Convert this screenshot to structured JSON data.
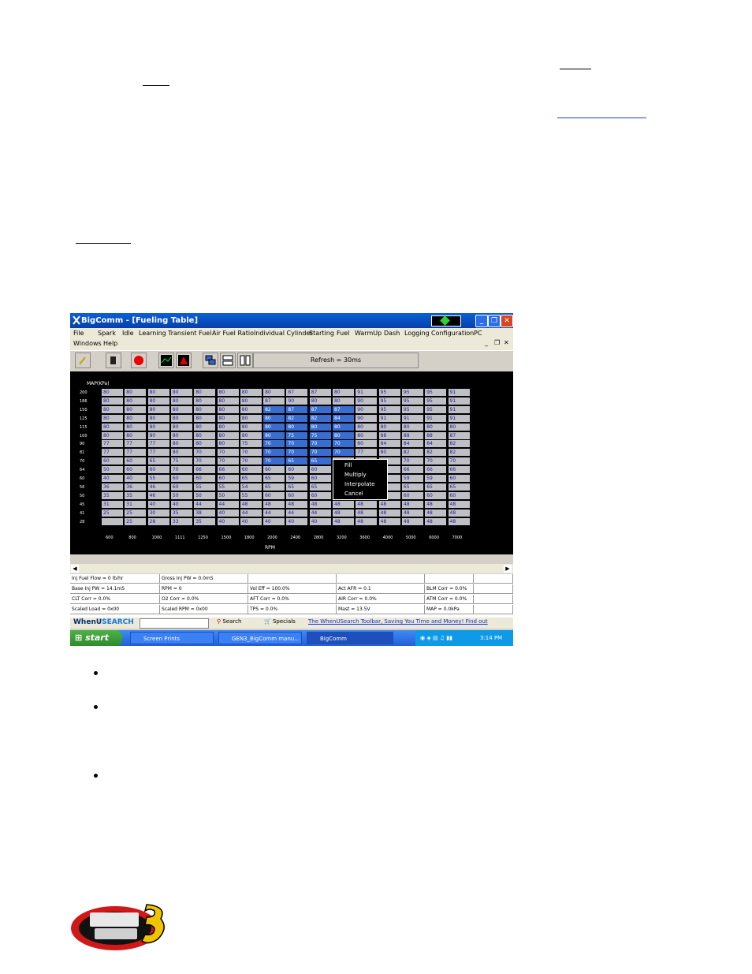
{
  "window": {
    "title": "BigComm - [Fueling Table]",
    "menu_row1": [
      "File",
      "Spark",
      "Idle",
      "Learning",
      "Transient Fuel",
      "Air Fuel Ratio",
      "Individual Cylinder",
      "Starting",
      "Fuel",
      "WarmUp",
      "Dash",
      "Logging",
      "Configuration",
      "PC"
    ],
    "menu_row2": [
      "Windows",
      "Help"
    ],
    "refresh_label": "Refresh = 30ms",
    "map_label": "MAP(KPa)",
    "rpm_label": "RPM",
    "rows": [
      "200",
      "186",
      "150",
      "125",
      "115",
      "100",
      "90",
      "81",
      "70",
      "64",
      "60",
      "56",
      "50",
      "45",
      "41",
      "28"
    ],
    "cols": [
      "600",
      "800",
      "1000",
      "1111",
      "1250",
      "1500",
      "1800",
      "2000",
      "2400",
      "2800",
      "3200",
      "3600",
      "4000",
      "5000",
      "6000",
      "7000"
    ],
    "grid": [
      [
        "80",
        "80",
        "80",
        "80",
        "80",
        "80",
        "80",
        "80",
        "87",
        "87",
        "80",
        "91",
        "95",
        "95",
        "95",
        "91"
      ],
      [
        "80",
        "80",
        "80",
        "80",
        "80",
        "80",
        "80",
        "87",
        "90",
        "80",
        "80",
        "90",
        "95",
        "95",
        "95",
        "91"
      ],
      [
        "80",
        "80",
        "80",
        "80",
        "80",
        "80",
        "80",
        "82",
        "87",
        "87",
        "87",
        "90",
        "95",
        "95",
        "95",
        "91"
      ],
      [
        "80",
        "80",
        "80",
        "80",
        "80",
        "80",
        "80",
        "80",
        "82",
        "82",
        "84",
        "90",
        "91",
        "91",
        "91",
        "91"
      ],
      [
        "80",
        "80",
        "80",
        "80",
        "80",
        "80",
        "80",
        "80",
        "80",
        "80",
        "80",
        "80",
        "80",
        "80",
        "80",
        "80"
      ],
      [
        "80",
        "80",
        "80",
        "80",
        "80",
        "80",
        "80",
        "80",
        "75",
        "75",
        "80",
        "80",
        "88",
        "88",
        "88",
        "87"
      ],
      [
        "77",
        "77",
        "77",
        "80",
        "80",
        "80",
        "75",
        "70",
        "70",
        "70",
        "70",
        "80",
        "84",
        "84",
        "84",
        "82"
      ],
      [
        "77",
        "77",
        "77",
        "80",
        "70",
        "70",
        "70",
        "70",
        "70",
        "70",
        "70",
        "77",
        "80",
        "82",
        "82",
        "82"
      ],
      [
        "60",
        "60",
        "65",
        "75",
        "70",
        "70",
        "70",
        "70",
        "65",
        "65",
        "",
        "",
        "",
        "70",
        "70",
        "70"
      ],
      [
        "50",
        "60",
        "60",
        "70",
        "66",
        "66",
        "60",
        "60",
        "60",
        "60",
        "",
        "",
        "",
        "66",
        "66",
        "66"
      ],
      [
        "40",
        "40",
        "55",
        "60",
        "60",
        "60",
        "65",
        "65",
        "59",
        "60",
        "",
        "",
        "",
        "59",
        "59",
        "60"
      ],
      [
        "36",
        "36",
        "46",
        "60",
        "55",
        "55",
        "54",
        "65",
        "65",
        "65",
        "",
        "",
        "",
        "65",
        "65",
        "65"
      ],
      [
        "35",
        "35",
        "46",
        "50",
        "50",
        "50",
        "55",
        "60",
        "60",
        "60",
        "",
        "",
        "",
        "60",
        "60",
        "60"
      ],
      [
        "31",
        "31",
        "40",
        "40",
        "44",
        "44",
        "48",
        "48",
        "48",
        "48",
        "48",
        "48",
        "48",
        "48",
        "48",
        "48"
      ],
      [
        "25",
        "25",
        "30",
        "35",
        "38",
        "40",
        "44",
        "44",
        "44",
        "44",
        "48",
        "48",
        "48",
        "48",
        "48",
        "48"
      ],
      [
        "",
        "25",
        "28",
        "33",
        "35",
        "40",
        "40",
        "40",
        "40",
        "40",
        "48",
        "48",
        "48",
        "48",
        "48",
        "48"
      ]
    ],
    "context_menu": [
      "Fill",
      "Multiply",
      "Interpolate",
      "Cancel"
    ],
    "status_rows": [
      [
        "Inj Fuel Flow = 0 lb/hr",
        "Gross Inj PW = 0.0mS",
        "",
        "",
        "",
        ""
      ],
      [
        "Base Inj PW = 14.1mS",
        "RPM = 0",
        "Vol Eff = 100.0%",
        "Act AFR = 0.1",
        "BLM Corr = 0.0%",
        ""
      ],
      [
        "CLT Corr = 0.0%",
        "O2 Corr = 0.0%",
        "AFT Corr = 0.0%",
        "AIR Corr = 0.0%",
        "ATM Corr = 0.0%",
        ""
      ],
      [
        "Scaled Load = 0x00",
        "Scaled RPM = 0x00",
        "TPS = 0.0%",
        "Mast = 13.5V",
        "MAP = 0.0kPa",
        ""
      ]
    ],
    "toolbar_ws": {
      "logo_when": "WhenU",
      "logo_search": "SEARCH",
      "search_btn": "Search",
      "specials": "Specials",
      "tagline": "The WhenUSearch Toolbar, Saving You Time and Money! Find out"
    },
    "taskbar": {
      "start": "start",
      "tasks": [
        "Screen Prints",
        "GEN3_BigComm manu...",
        "BigComm"
      ],
      "clock": "3:14 PM"
    }
  }
}
